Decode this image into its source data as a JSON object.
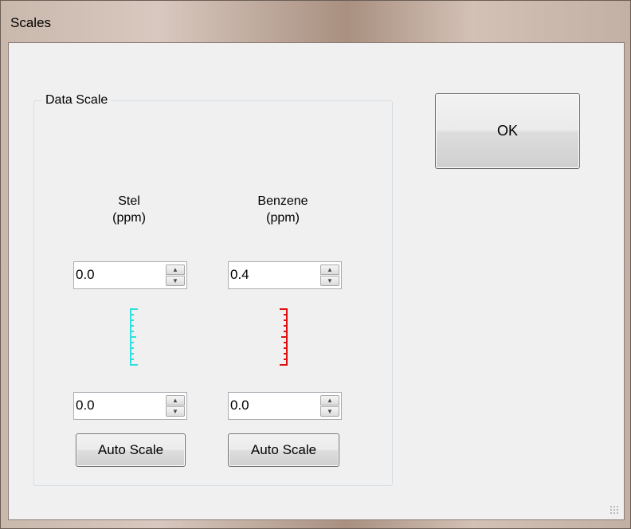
{
  "window": {
    "title": "Scales"
  },
  "group": {
    "label": "Data Scale"
  },
  "columns": [
    {
      "header_line1": "Stel",
      "header_line2": "(ppm)",
      "max_value": "0.0",
      "min_value": "0.0",
      "auto_scale_label": "Auto Scale",
      "ruler_color": "#2ee0e0"
    },
    {
      "header_line1": "Benzene",
      "header_line2": "(ppm)",
      "max_value": "0.4",
      "min_value": "0.0",
      "auto_scale_label": "Auto Scale",
      "ruler_color": "#e01010"
    }
  ],
  "ok_button": {
    "label": "OK"
  },
  "icons": {
    "spin_up": "up-arrow-icon",
    "spin_down": "down-arrow-icon"
  }
}
